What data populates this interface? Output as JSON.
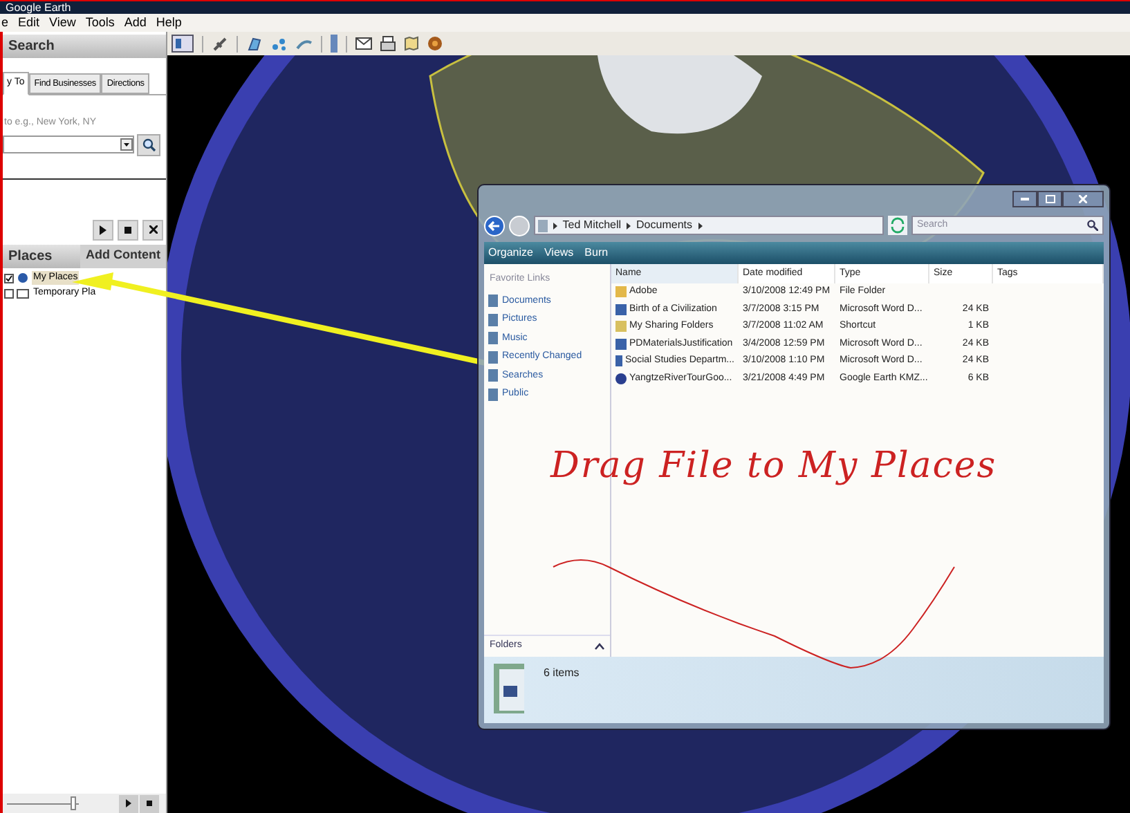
{
  "window": {
    "title": "Google Earth"
  },
  "menu": [
    "e",
    "Edit",
    "View",
    "Tools",
    "Add",
    "Help"
  ],
  "search_panel": {
    "title": "Search",
    "tabs": [
      {
        "label": "y To",
        "selected": true
      },
      {
        "label": "Find Businesses",
        "selected": false
      },
      {
        "label": "Directions",
        "selected": false
      }
    ],
    "hint": "to e.g., New York, NY"
  },
  "places_panel": {
    "title": "Places",
    "button": "Add Content",
    "items": [
      {
        "label": "My Places",
        "checked": true,
        "selected": true
      },
      {
        "label": "Temporary Pla",
        "checked": false,
        "selected": false
      }
    ]
  },
  "tour_slider": {
    "level": 0.92
  },
  "explorer": {
    "breadcrumb": [
      "Ted Mitchell",
      "Documents"
    ],
    "search_placeholder": "Search",
    "toolbar": [
      "Organize",
      "Views",
      "Burn"
    ],
    "favorites_title": "Favorite Links",
    "favorites": [
      "Documents",
      "Pictures",
      "Music",
      "Recently Changed",
      "Searches",
      "Public"
    ],
    "columns": [
      "Name",
      "Date modified",
      "Type",
      "Size",
      "Tags"
    ],
    "rows": [
      {
        "kind": "folder",
        "cells": [
          "Adobe",
          "3/10/2008 12:49 PM",
          "File Folder",
          ""
        ]
      },
      {
        "kind": "doc",
        "cells": [
          "Birth of a Civilization",
          "3/7/2008 3:15 PM",
          "Microsoft Word D...",
          "24 KB"
        ]
      },
      {
        "kind": "shortcut",
        "cells": [
          "My Sharing Folders",
          "3/7/2008 11:02 AM",
          "Shortcut",
          "1 KB"
        ]
      },
      {
        "kind": "doc",
        "cells": [
          "PDMaterialsJustification",
          "3/4/2008 12:59 PM",
          "Microsoft Word D...",
          "24 KB"
        ]
      },
      {
        "kind": "doc",
        "cells": [
          "Social Studies Departm...",
          "3/10/2008 1:10 PM",
          "Microsoft Word D...",
          "24 KB"
        ]
      },
      {
        "kind": "kmz",
        "cells": [
          "YangtzeRiverTourGoo...",
          "3/21/2008 4:49 PM",
          "Google Earth KMZ...",
          "6 KB"
        ]
      }
    ],
    "folders_label": "Folders",
    "status": "6 items"
  },
  "annotation": {
    "text": "Drag File to My Places"
  }
}
